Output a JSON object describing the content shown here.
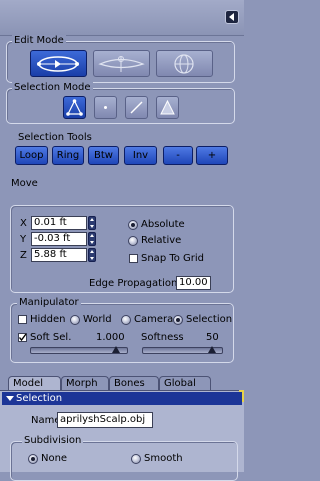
{
  "edit_mode": {
    "legend": "Edit Mode",
    "buttons": [
      {
        "icon": "edit-transform-icon",
        "active": true
      },
      {
        "icon": "edit-morph-icon",
        "active": false
      },
      {
        "icon": "edit-sphere-icon",
        "active": false
      }
    ]
  },
  "selection_mode": {
    "legend": "Selection Mode",
    "buttons": [
      {
        "icon": "vertex-select-icon",
        "active": true
      },
      {
        "icon": "point-select-icon",
        "active": false
      },
      {
        "icon": "edge-select-icon",
        "active": false
      },
      {
        "icon": "face-select-icon",
        "active": false
      }
    ]
  },
  "selection_tools": {
    "label": "Selection Tools",
    "buttons": [
      "Loop",
      "Ring",
      "Btw",
      "Inv",
      "-",
      "+"
    ]
  },
  "move": {
    "label": "Move",
    "x_label": "X",
    "x_value": "0.01 ft",
    "y_label": "Y",
    "y_value": "-0.03 ft",
    "z_label": "Z",
    "z_value": "5.88 ft",
    "absolute_label": "Absolute",
    "relative_label": "Relative",
    "snap_label": "Snap To Grid",
    "mode_selected": "Absolute",
    "snap_checked": false,
    "edge_propagation_label": "Edge Propagation",
    "edge_propagation_value": "10.00"
  },
  "manipulator": {
    "legend": "Manipulator",
    "hidden_label": "Hidden",
    "hidden_checked": false,
    "world_label": "World",
    "camera_label": "Camera",
    "selection_label": "Selection",
    "space_selected": "Selection",
    "soft_sel_label": "Soft Sel.",
    "soft_sel_checked": true,
    "soft_sel_value": "1.000",
    "softness_label": "Softness",
    "softness_value": "50",
    "soft_sel_slider_fraction": 0.88,
    "softness_slider_fraction": 0.86
  },
  "tabs": [
    "Model",
    "Morph",
    "Bones",
    "Global"
  ],
  "active_tab": "Model",
  "selection_section": {
    "header": "Selection",
    "name_label": "Name",
    "name_value": "aprilyshScalp.obj",
    "subdivision_legend": "Subdivision",
    "none_label": "None",
    "smooth_label": "Smooth",
    "subdivision_selected": "None"
  },
  "colors": {
    "panel_bg": "#8d96b8",
    "active_button": "#2a52c8",
    "section_header": "#1c3597"
  }
}
